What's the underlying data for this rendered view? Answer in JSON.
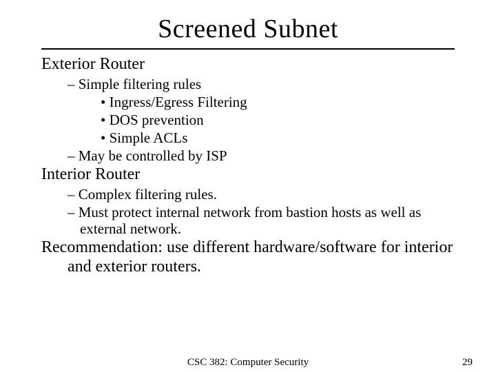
{
  "title": "Screened Subnet",
  "sections": [
    {
      "heading": "Exterior Router",
      "items": [
        {
          "text": "Simple filtering rules",
          "sub": [
            "Ingress/Egress Filtering",
            "DOS prevention",
            "Simple ACLs"
          ]
        },
        {
          "text": "May be controlled by ISP"
        }
      ]
    },
    {
      "heading": "Interior Router",
      "items": [
        {
          "text": "Complex filtering rules."
        },
        {
          "text": "Must protect internal network from bastion hosts as well as external network."
        }
      ]
    }
  ],
  "recommendation": "Recommendation: use different hardware/software for interior and exterior routers.",
  "footer": {
    "center": "CSC 382: Computer Security",
    "page": "29"
  }
}
